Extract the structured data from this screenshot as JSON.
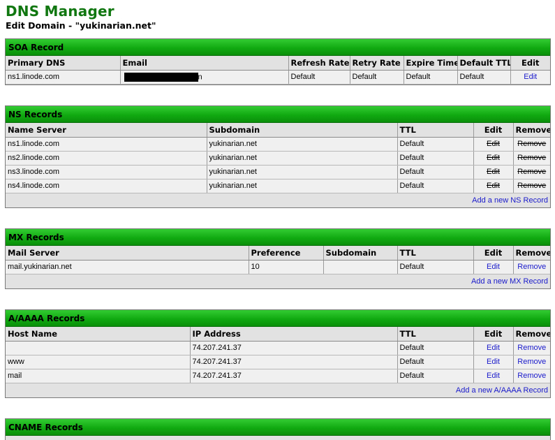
{
  "page": {
    "title": "DNS Manager",
    "subtitle": "Edit Domain - \"yukinarian.net\""
  },
  "colors": {
    "title_green": "#117711",
    "header_green": "#22bb22",
    "link_blue": "#1a1acc",
    "panel_gray": "#e2e2e2",
    "row_gray": "#f0f0f0"
  },
  "soa": {
    "title": "SOA Record",
    "headers": [
      "Primary DNS",
      "Email",
      "Refresh Rate",
      "Retry Rate",
      "Expire Time",
      "Default TTL",
      "Edit"
    ],
    "row": {
      "primary_dns": "ns1.linode.com",
      "email_suffix": "n",
      "refresh": "Default",
      "retry": "Default",
      "expire": "Default",
      "ttl": "Default",
      "edit": "Edit"
    }
  },
  "ns": {
    "title": "NS Records",
    "headers": [
      "Name Server",
      "Subdomain",
      "TTL",
      "Edit",
      "Remove"
    ],
    "rows": [
      {
        "server": "ns1.linode.com",
        "subdomain": "yukinarian.net",
        "ttl": "Default",
        "edit": "Edit",
        "remove": "Remove"
      },
      {
        "server": "ns2.linode.com",
        "subdomain": "yukinarian.net",
        "ttl": "Default",
        "edit": "Edit",
        "remove": "Remove"
      },
      {
        "server": "ns3.linode.com",
        "subdomain": "yukinarian.net",
        "ttl": "Default",
        "edit": "Edit",
        "remove": "Remove"
      },
      {
        "server": "ns4.linode.com",
        "subdomain": "yukinarian.net",
        "ttl": "Default",
        "edit": "Edit",
        "remove": "Remove"
      }
    ],
    "add_label": "Add a new NS Record"
  },
  "mx": {
    "title": "MX Records",
    "headers": [
      "Mail Server",
      "Preference",
      "Subdomain",
      "TTL",
      "Edit",
      "Remove"
    ],
    "rows": [
      {
        "server": "mail.yukinarian.net",
        "preference": "10",
        "subdomain": "",
        "ttl": "Default",
        "edit": "Edit",
        "remove": "Remove"
      }
    ],
    "add_label": "Add a new MX Record"
  },
  "a": {
    "title": "A/AAAA Records",
    "headers": [
      "Host Name",
      "IP Address",
      "TTL",
      "Edit",
      "Remove"
    ],
    "rows": [
      {
        "host": "",
        "ip": "74.207.241.37",
        "ttl": "Default",
        "edit": "Edit",
        "remove": "Remove"
      },
      {
        "host": "www",
        "ip": "74.207.241.37",
        "ttl": "Default",
        "edit": "Edit",
        "remove": "Remove"
      },
      {
        "host": "mail",
        "ip": "74.207.241.37",
        "ttl": "Default",
        "edit": "Edit",
        "remove": "Remove"
      }
    ],
    "add_label": "Add a new A/AAAA Record"
  },
  "cname": {
    "title": "CNAME Records"
  }
}
